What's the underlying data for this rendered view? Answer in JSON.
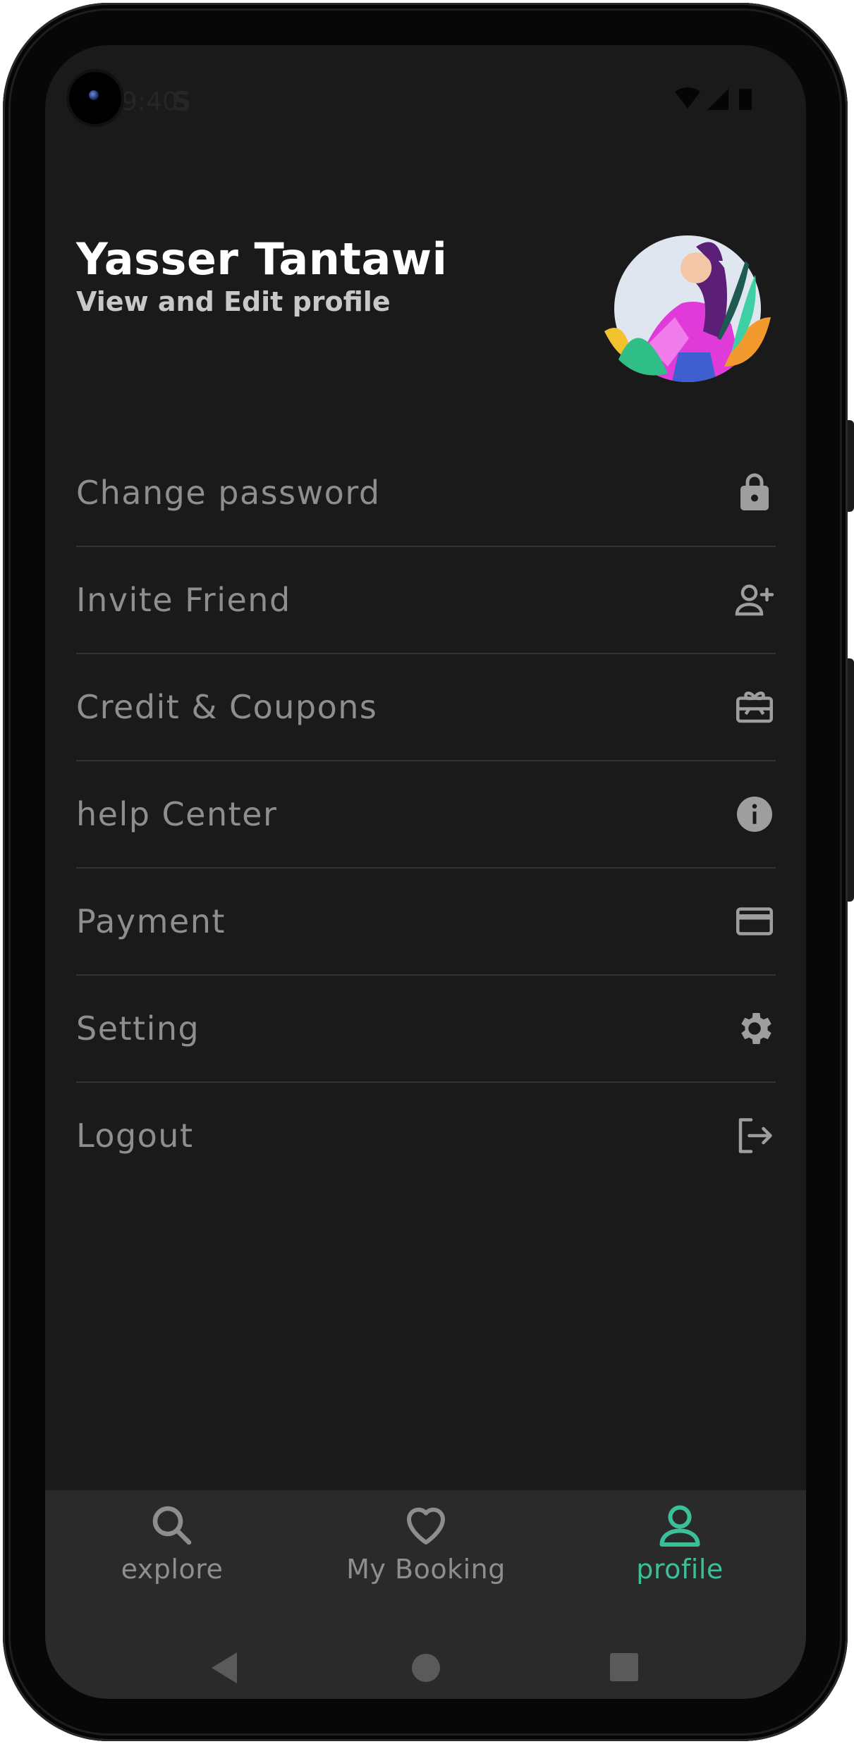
{
  "status_bar": {
    "time": "9:40",
    "extra": "S"
  },
  "profile": {
    "name": "Yasser Tantawi",
    "subtitle": "View and Edit profile"
  },
  "menu": {
    "items": [
      {
        "label": "Change password",
        "icon": "lock-icon"
      },
      {
        "label": "Invite Friend",
        "icon": "person-add-icon"
      },
      {
        "label": "Credit & Coupons",
        "icon": "gift-card-icon"
      },
      {
        "label": "help Center",
        "icon": "info-icon"
      },
      {
        "label": "Payment",
        "icon": "credit-card-icon"
      },
      {
        "label": "Setting",
        "icon": "gear-icon"
      },
      {
        "label": "Logout",
        "icon": "logout-icon"
      }
    ]
  },
  "bottom_nav": {
    "items": [
      {
        "label": "explore",
        "icon": "search-icon"
      },
      {
        "label": "My Booking",
        "icon": "heart-icon"
      },
      {
        "label": "profile",
        "icon": "person-icon",
        "active": true
      }
    ]
  },
  "colors": {
    "background": "#1a1a1a",
    "nav_background": "#2a2a2a",
    "accent": "#3bbf99",
    "muted_text": "#8e8e8e",
    "icon": "#9e9e9e"
  }
}
